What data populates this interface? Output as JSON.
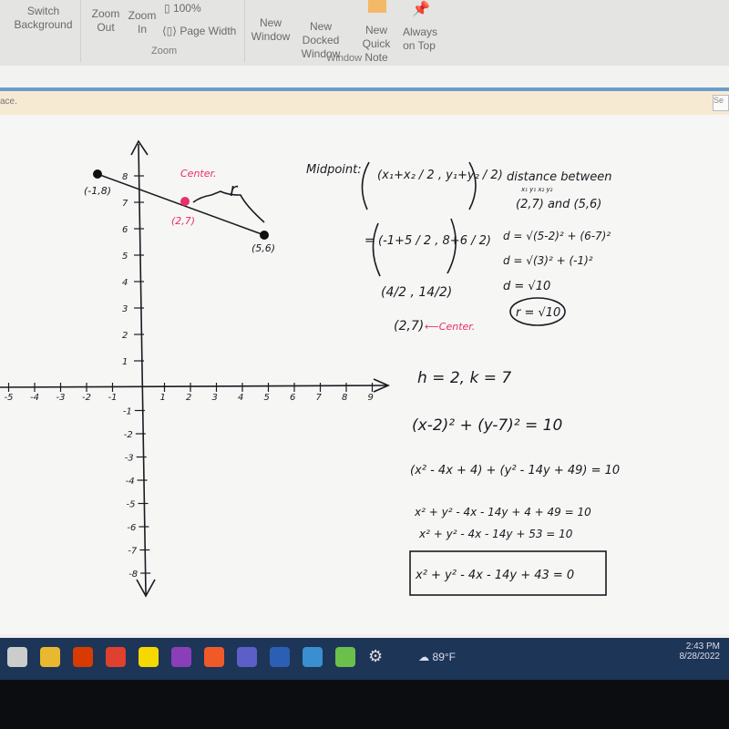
{
  "ribbon": {
    "switch_background": "Switch Background",
    "zoom_out": "Zoom Out",
    "zoom_in": "Zoom In",
    "zoom_percent": "100%",
    "page_width": "Page Width",
    "zoom_group": "Zoom",
    "new_window": "New Window",
    "new_docked_window": "New Docked Window",
    "new_quick_note": "New Quick Note",
    "always_on_top": "Always on Top",
    "window_group": "Window"
  },
  "infobar": {
    "text": "ace.",
    "button": "Se"
  },
  "note": {
    "graph": {
      "x_ticks": [
        "-5",
        "-4",
        "-3",
        "-2",
        "-1",
        "1",
        "2",
        "3",
        "4",
        "5",
        "6",
        "7",
        "8",
        "9"
      ],
      "y_ticks_pos": [
        "8",
        "7",
        "6",
        "5",
        "4",
        "3",
        "2",
        "1"
      ],
      "y_ticks_neg": [
        "-1",
        "-2",
        "-3",
        "-4",
        "-5",
        "-6",
        "-7",
        "-8"
      ],
      "point_a": "(-1,8)",
      "point_b": "(5,6)",
      "center_label": "Center.",
      "center_point": "(2,7)",
      "radius_label": "r",
      "center_color": "#e8306a"
    },
    "midpoint": {
      "label": "Midpoint:",
      "formula": "(x₁+x₂ / 2 , y₁+y₂ / 2)",
      "step1": "= (-1+5 / 2 , 8+6 / 2)",
      "step2": "(4/2 , 14/2)",
      "result": "(2,7)",
      "result_note": "⟵Center."
    },
    "distance": {
      "title": "distance between",
      "points": "(2,7) and (5,6)",
      "labels": "x₁ y₁        x₂ y₂",
      "step1": "d = √(5-2)² + (6-7)²",
      "step2": "d = √(3)² + (-1)²",
      "step3": "d = √10",
      "result": "r = √10"
    },
    "equations": {
      "hk": "h = 2, k = 7",
      "standard": "(x-2)² + (y-7)² = 10",
      "expanded": "(x² - 4x + 4) + (y² - 14y + 49) = 10",
      "combined1": "x² + y² - 4x - 14y + 4 + 49 = 10",
      "combined2": "x² + y² - 4x - 14y + 53 = 10",
      "final": "x² + y² - 4x - 14y + 43 = 0"
    }
  },
  "taskbar": {
    "apps": [
      "start",
      "chrome",
      "office",
      "app-red",
      "pacman",
      "onenote",
      "origin",
      "teams",
      "word",
      "photos",
      "app-green",
      "settings"
    ],
    "weather": "89°F",
    "time": "2:43 PM",
    "date": "8/28/2022"
  }
}
